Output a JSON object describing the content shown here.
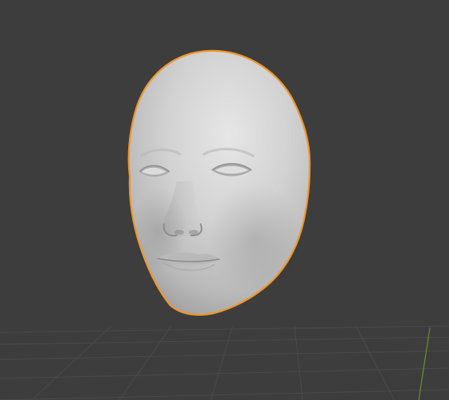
{
  "viewport": {
    "background": "#3d3d3d",
    "grid_color": "#4a4a4a",
    "y_axis_color": "#6a8f2d",
    "selection_outline": "#f0952a"
  },
  "scene": {
    "object": {
      "icon": "head-mesh",
      "selected": true,
      "shading": "solid"
    }
  }
}
